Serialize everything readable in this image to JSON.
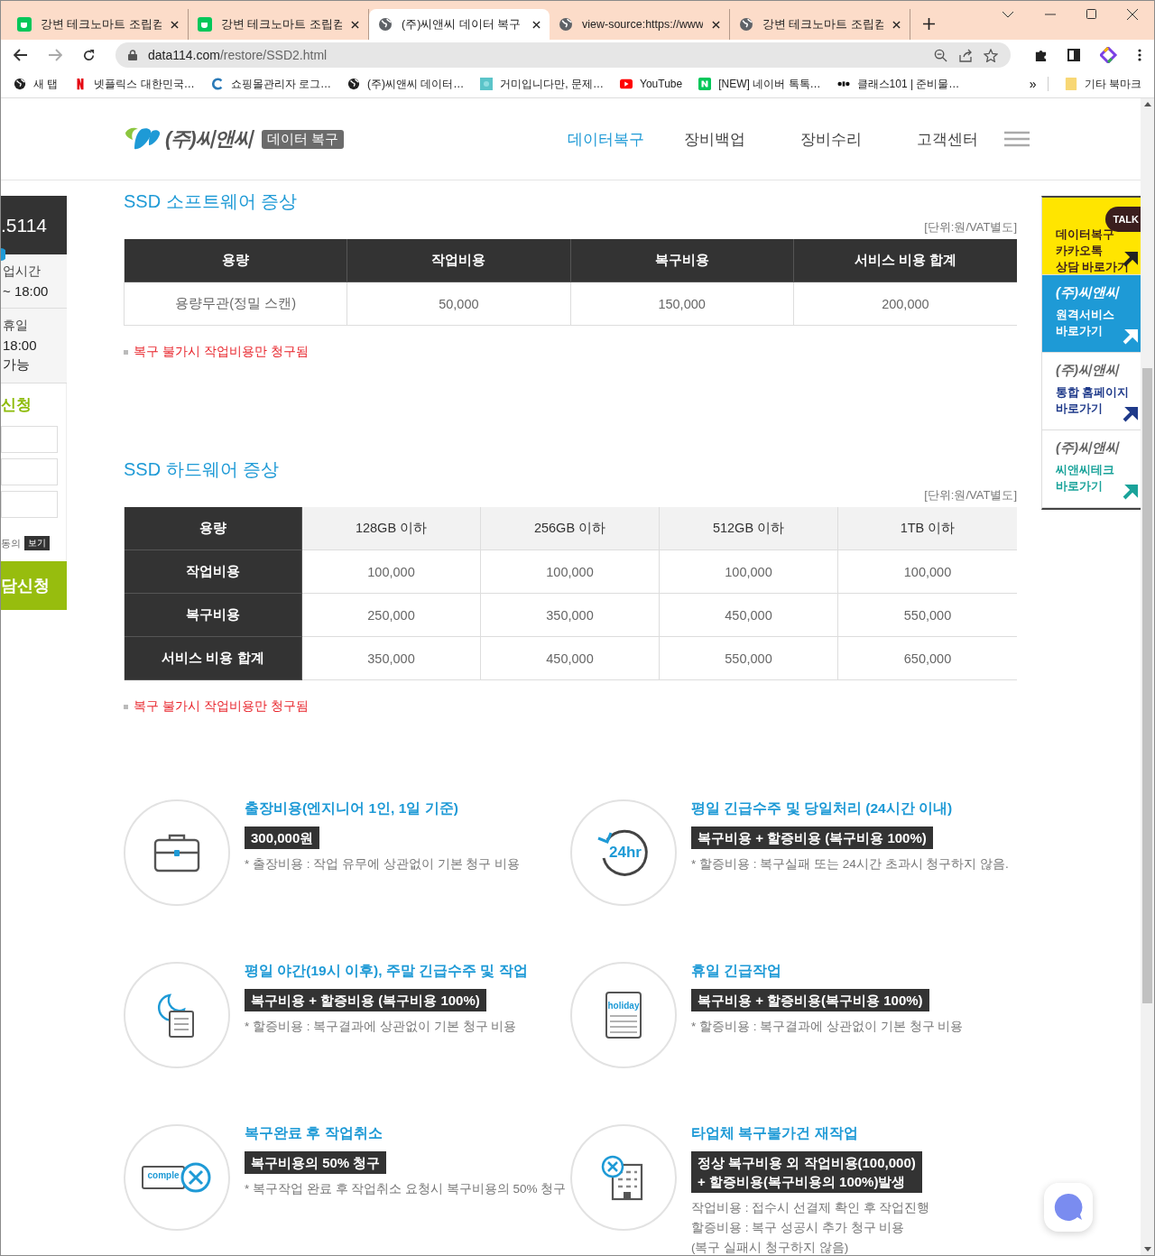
{
  "browser": {
    "tabs": [
      {
        "title": "강변 테크노마트 조립컴",
        "kind": "cafe",
        "selected": false
      },
      {
        "title": "강변 테크노마트 조립컴",
        "kind": "cafe",
        "selected": false
      },
      {
        "title": "(주)씨앤씨 데이터 복구",
        "kind": "globe",
        "selected": true
      },
      {
        "title": "view-source:https://www",
        "kind": "globe",
        "selected": false
      },
      {
        "title": "강변 테크노마트 조립컴",
        "kind": "globe",
        "selected": false
      }
    ],
    "address": {
      "host": "data114.com",
      "path": "/restore/SSD2.html"
    },
    "bookmarks": [
      {
        "label": "새 탭",
        "kind": "globe"
      },
      {
        "label": "넷플릭스 대한민국…",
        "kind": "netflix"
      },
      {
        "label": "쇼핑몰관리자 로그…",
        "kind": "ring"
      },
      {
        "label": "(주)씨앤씨 데이터…",
        "kind": "globe"
      },
      {
        "label": "거미입니다만, 문제…",
        "kind": "video"
      },
      {
        "label": "YouTube",
        "kind": "youtube"
      },
      {
        "label": "[NEW] 네이버 톡톡…",
        "kind": "naver"
      },
      {
        "label": "클래스101 | 준비물…",
        "kind": "dots"
      }
    ],
    "more": "»",
    "other_bookmarks": "기타 북마크"
  },
  "header": {
    "logo_brand": "(주)씨앤씨",
    "logo_tag": "데이터 복구",
    "nav": [
      {
        "label": "데이터복구",
        "selected": true
      },
      {
        "label": "장비백업",
        "selected": false
      },
      {
        "label": "장비수리",
        "selected": false
      },
      {
        "label": "고객센터",
        "selected": false
      }
    ]
  },
  "left_panel": {
    "phone": ".5114",
    "hours_label": "업시간",
    "hours": "~ 18:00",
    "holiday_label": "휴일",
    "holiday_hours": "18:00",
    "holiday_note": "가능",
    "form_title": "신청",
    "agree": "동의",
    "view_button": "보기",
    "submit": "담신청"
  },
  "software": {
    "title": "SSD 소프트웨어 증상",
    "unit": "[단위:원/VAT별도]",
    "columns": [
      "용량",
      "작업비용",
      "복구비용",
      "서비스 비용 합계"
    ],
    "rows": [
      [
        "용량무관(정밀 스캔)",
        "50,000",
        "150,000",
        "200,000"
      ]
    ],
    "note": "복구 불가시 작업비용만 청구됨"
  },
  "hardware": {
    "title": "SSD 하드웨어 증상",
    "unit": "[단위:원/VAT별도]",
    "columns": [
      "용량",
      "128GB 이하",
      "256GB 이하",
      "512GB 이하",
      "1TB 이하"
    ],
    "rows": [
      [
        "작업비용",
        "100,000",
        "100,000",
        "100,000",
        "100,000"
      ],
      [
        "복구비용",
        "250,000",
        "350,000",
        "450,000",
        "550,000"
      ],
      [
        "서비스 비용 합계",
        "350,000",
        "450,000",
        "550,000",
        "650,000"
      ]
    ],
    "note": "복구 불가시 작업비용만 청구됨"
  },
  "fees": [
    {
      "kind": "briefcase",
      "title": "출장비용(엔지니어 1인, 1일 기준)",
      "badge": [
        "300,000원"
      ],
      "notes": [
        "* 출장비용 : 작업 유무에 상관없이 기본 청구 비용"
      ]
    },
    {
      "kind": "clock",
      "icon_text": "24hr",
      "title": "평일 긴급수주 및 당일처리 (24시간 이내)",
      "badge": [
        "복구비용 + 할증비용 (복구비용 100%)"
      ],
      "notes": [
        "* 할증비용 : 복구실패 또는 24시간 초과시 청구하지 않음."
      ]
    },
    {
      "kind": "moon",
      "title": "평일 야간(19시 이후), 주말 긴급수주 및 작업",
      "badge": [
        "복구비용 + 할증비용 (복구비용 100%)"
      ],
      "notes": [
        "* 할증비용 : 복구결과에 상관없이 기본 청구 비용"
      ]
    },
    {
      "kind": "calendar",
      "icon_text": "holiday",
      "title": "휴일 긴급작업",
      "badge": [
        "복구비용 + 할증비용(복구비용 100%)"
      ],
      "notes": [
        "* 할증비용 : 복구결과에 상관없이 기본 청구 비용"
      ]
    },
    {
      "kind": "cancel",
      "icon_text": "comple",
      "title": "복구완료 후 작업취소",
      "badge": [
        "복구비용의 50% 청구"
      ],
      "notes": [
        "* 복구작업 완료 후 작업취소 요청시 복구비용의 50% 청구"
      ]
    },
    {
      "kind": "building",
      "title": "타업체 복구불가건 재작업",
      "badge": [
        "정상 복구비용 외 작업비용(100,000)",
        "+ 할증비용(복구비용의 100%)발생"
      ],
      "notes": [
        "작업비용 : 접수시 선결제 확인 후 작업진행",
        "할증비용 : 복구 성공시 추가 청구 비용",
        "(복구 실패시 청구하지 않음)"
      ]
    }
  ],
  "right_panel": [
    {
      "kind": "kakao",
      "lines": [
        "데이터복구",
        "카카오톡",
        "상담 바로가기"
      ],
      "badge": "TALK"
    },
    {
      "kind": "remote",
      "brand": "(주)씨앤씨",
      "lines": [
        "원격서비스",
        "바로가기"
      ]
    },
    {
      "kind": "home",
      "brand": "(주)씨앤씨",
      "lines": [
        "통합 홈페이지",
        "바로가기"
      ]
    },
    {
      "kind": "tech",
      "brand": "(주)씨앤씨",
      "lines": [
        "씨앤씨테크",
        "바로가기"
      ]
    }
  ]
}
